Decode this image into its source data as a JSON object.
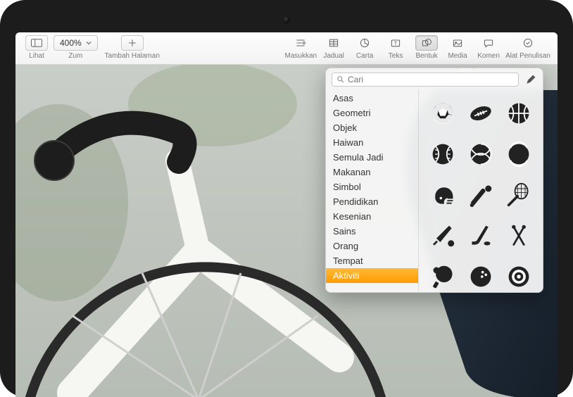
{
  "toolbar": {
    "view_label": "Lihat",
    "zoom_label": "Zum",
    "zoom_value": "400%",
    "add_page_label": "Tambah Halaman",
    "insert_label": "Masukkan",
    "table_label": "Jadual",
    "chart_label": "Carta",
    "text_label": "Teks",
    "shape_label": "Bentuk",
    "media_label": "Media",
    "comment_label": "Komen",
    "authoring_label": "Alat Penulisan"
  },
  "popover": {
    "search_placeholder": "Cari",
    "categories": [
      "Asas",
      "Geometri",
      "Objek",
      "Haiwan",
      "Semula Jadi",
      "Makanan",
      "Simbol",
      "Pendidikan",
      "Kesenian",
      "Sains",
      "Orang",
      "Tempat",
      "Aktiviti"
    ],
    "selected_category": "Aktiviti",
    "shapes": [
      "soccer-ball",
      "american-football",
      "basketball",
      "baseball",
      "volleyball",
      "tennis-ball",
      "football-helmet",
      "baseball-bat",
      "tennis-racket",
      "cricket-bat",
      "hockey-stick",
      "ski-poles",
      "ping-pong",
      "bowling-ball",
      "dartboard",
      "bicycle",
      "bicycle"
    ]
  }
}
